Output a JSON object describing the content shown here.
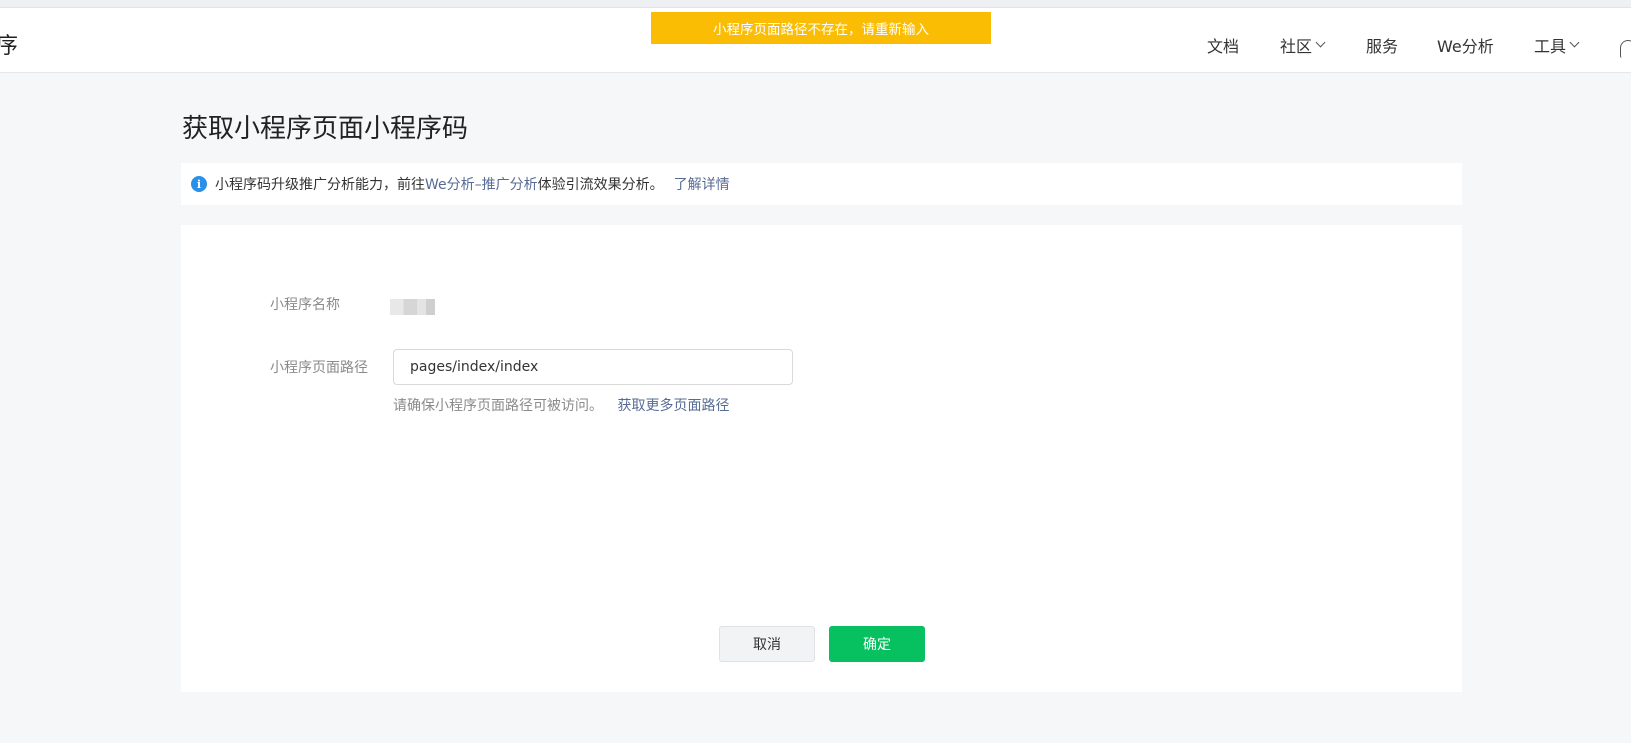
{
  "header": {
    "brand_partial": "序",
    "nav": [
      {
        "label": "文档",
        "has_dropdown": false
      },
      {
        "label": "社区",
        "has_dropdown": true
      },
      {
        "label": "服务",
        "has_dropdown": false
      },
      {
        "label": "We分析",
        "has_dropdown": false
      },
      {
        "label": "工具",
        "has_dropdown": true
      }
    ],
    "notification_icon": "bell-icon"
  },
  "toast": {
    "message": "小程序页面路径不存在，请重新输入",
    "color": "#fbbd04"
  },
  "page": {
    "title": "获取小程序页面小程序码"
  },
  "notice": {
    "icon": "info-icon",
    "text_before": "小程序码升级推广分析能力，前往",
    "link_analysis": "We分析–推广分析",
    "text_after": "体验引流效果分析。",
    "link_more": "了解详情"
  },
  "form": {
    "name_label": "小程序名称",
    "path_label": "小程序页面路径",
    "path_value": "pages/index/index",
    "hint_text": "请确保小程序页面路径可被访问。",
    "hint_link": "获取更多页面路径"
  },
  "buttons": {
    "cancel": "取消",
    "confirm": "确定"
  },
  "colors": {
    "primary": "#07c160",
    "link": "#576b95",
    "info": "#2a8fe8"
  }
}
